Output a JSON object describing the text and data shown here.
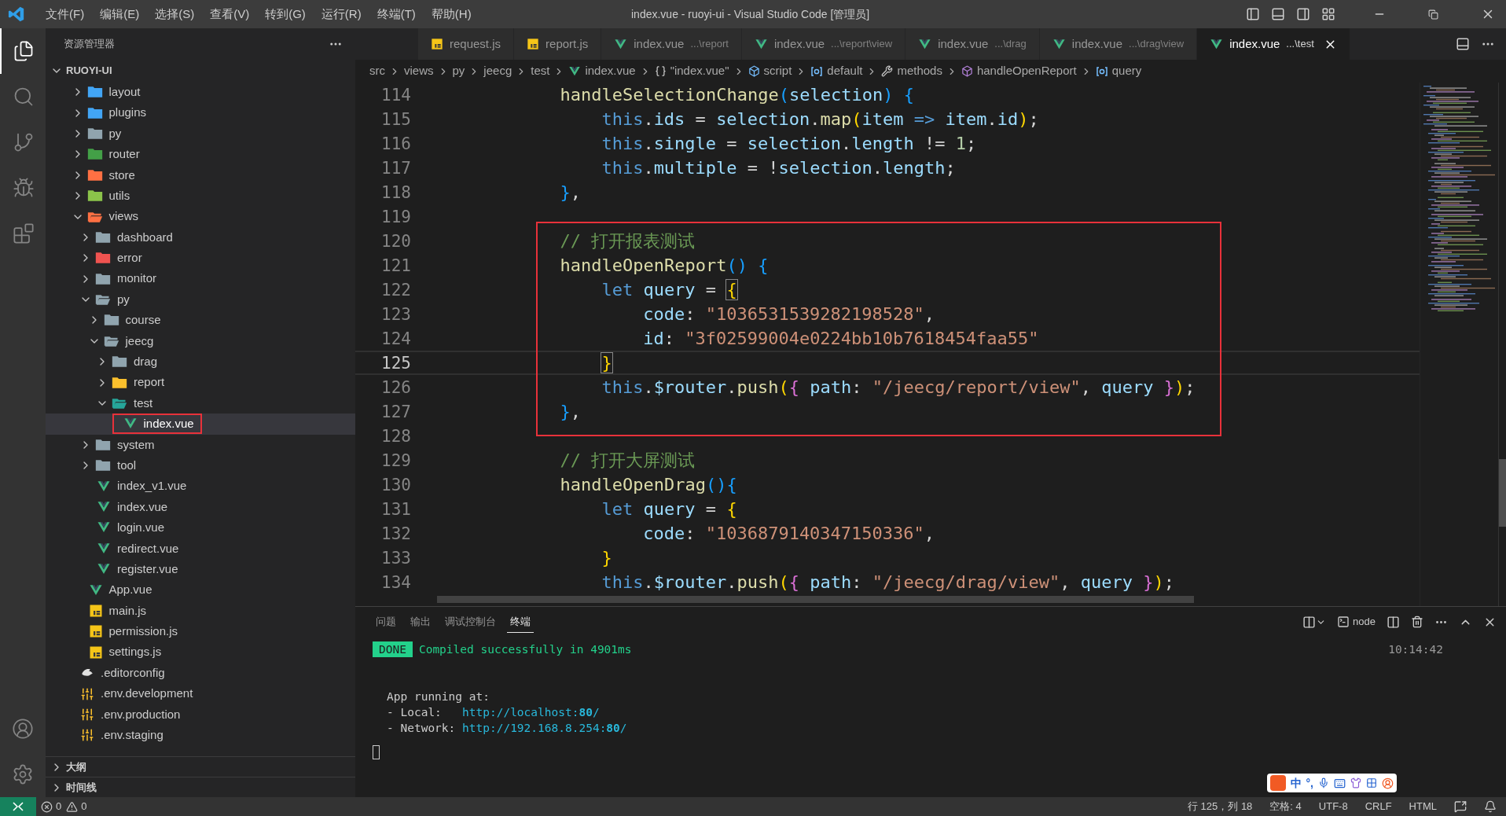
{
  "title_bar": {
    "menus": [
      "文件(F)",
      "编辑(E)",
      "选择(S)",
      "查看(V)",
      "转到(G)",
      "运行(R)",
      "终端(T)",
      "帮助(H)"
    ],
    "title": "index.vue - ruoyi-ui - Visual Studio Code [管理员]"
  },
  "activity_bar": {
    "items": [
      {
        "kind": "explorer",
        "selected": true
      },
      {
        "kind": "search",
        "selected": false
      },
      {
        "kind": "scm",
        "selected": false
      },
      {
        "kind": "debug",
        "selected": false
      },
      {
        "kind": "extensions",
        "selected": false
      }
    ],
    "bottom": [
      {
        "kind": "account"
      },
      {
        "kind": "settings"
      }
    ]
  },
  "explorer": {
    "title": "资源管理器",
    "root": "RUOYI-UI",
    "root_expanded": true,
    "tree": [
      {
        "children": [
          {
            "label": "layout",
            "kind": "folder",
            "color": "#42a5f5",
            "expanded": false
          },
          {
            "label": "plugins",
            "kind": "folder",
            "color": "#42a5f5",
            "expanded": false
          },
          {
            "label": "py",
            "kind": "folder",
            "color": "#90a4ae",
            "expanded": false
          },
          {
            "label": "router",
            "kind": "folder",
            "color": "#43a047",
            "expanded": false
          },
          {
            "label": "store",
            "kind": "folder",
            "color": "#ff7043",
            "expanded": false
          },
          {
            "label": "utils",
            "kind": "folder",
            "color": "#8bc34a",
            "expanded": false
          },
          {
            "label": "views",
            "kind": "folder",
            "color": "#ff7043",
            "expanded": true,
            "children": [
              {
                "label": "dashboard",
                "kind": "folder",
                "color": "#90a4ae",
                "expanded": false
              },
              {
                "label": "error",
                "kind": "folder",
                "color": "#ef5350",
                "expanded": false
              },
              {
                "label": "monitor",
                "kind": "folder",
                "color": "#90a4ae",
                "expanded": false
              },
              {
                "label": "py",
                "kind": "folder",
                "color": "#90a4ae",
                "expanded": true,
                "children": [
                  {
                    "label": "course",
                    "kind": "folder",
                    "color": "#90a4ae",
                    "expanded": false
                  },
                  {
                    "label": "jeecg",
                    "kind": "folder",
                    "color": "#90a4ae",
                    "expanded": true,
                    "children": [
                      {
                        "label": "drag",
                        "kind": "folder",
                        "color": "#90a4ae",
                        "expanded": false
                      },
                      {
                        "label": "report",
                        "kind": "folder",
                        "color": "#fbc02d",
                        "expanded": false
                      },
                      {
                        "label": "test",
                        "kind": "folder",
                        "color": "#26a69a",
                        "expanded": true,
                        "children": [
                          {
                            "label": "index.vue",
                            "kind": "vue",
                            "selected": true,
                            "boxed": true
                          }
                        ]
                      }
                    ]
                  }
                ]
              },
              {
                "label": "system",
                "kind": "folder",
                "color": "#90a4ae",
                "expanded": false
              },
              {
                "label": "tool",
                "kind": "folder",
                "color": "#90a4ae",
                "expanded": false
              },
              {
                "label": "index_v1.vue",
                "kind": "vue",
                "selected": false
              },
              {
                "label": "index.vue",
                "kind": "vue",
                "selected": false
              },
              {
                "label": "login.vue",
                "kind": "vue",
                "selected": false
              },
              {
                "label": "redirect.vue",
                "kind": "vue",
                "selected": false
              },
              {
                "label": "register.vue",
                "kind": "vue",
                "selected": false
              }
            ]
          },
          {
            "label": "App.vue",
            "kind": "vue",
            "selected": false
          },
          {
            "label": "main.js",
            "kind": "js",
            "selected": false
          },
          {
            "label": "permission.js",
            "kind": "js",
            "selected": false
          },
          {
            "label": "settings.js",
            "kind": "js",
            "selected": false
          }
        ]
      },
      {
        "label": ".editorconfig",
        "kind": "editorconfig",
        "selected": false
      },
      {
        "label": ".env.development",
        "kind": "env",
        "selected": false
      },
      {
        "label": ".env.production",
        "kind": "env",
        "selected": false
      },
      {
        "label": ".env.staging",
        "kind": "env",
        "selected": false
      }
    ],
    "sections": [
      {
        "label": "大纲",
        "expanded": false
      },
      {
        "label": "时间线",
        "expanded": false
      }
    ]
  },
  "tabs": [
    {
      "label": "request.js",
      "kind": "js",
      "selected": false
    },
    {
      "label": "report.js",
      "kind": "js",
      "selected": false
    },
    {
      "label": "index.vue",
      "detail": "...\\report",
      "kind": "vue",
      "selected": false
    },
    {
      "label": "index.vue",
      "detail": "...\\report\\view",
      "kind": "vue",
      "selected": false
    },
    {
      "label": "index.vue",
      "detail": "...\\drag",
      "kind": "vue",
      "selected": false
    },
    {
      "label": "index.vue",
      "detail": "...\\drag\\view",
      "kind": "vue",
      "selected": false
    },
    {
      "label": "index.vue",
      "detail": "...\\test",
      "kind": "vue",
      "selected": true
    }
  ],
  "breadcrumb": [
    {
      "label": "src",
      "kind": "path"
    },
    {
      "label": "views",
      "kind": "path"
    },
    {
      "label": "py",
      "kind": "path"
    },
    {
      "label": "jeecg",
      "kind": "path"
    },
    {
      "label": "test",
      "kind": "path"
    },
    {
      "label": "index.vue",
      "kind": "vue"
    },
    {
      "label": "\"index.vue\"",
      "kind": "braces"
    },
    {
      "label": "script",
      "kind": "cube"
    },
    {
      "label": "default",
      "kind": "ref"
    },
    {
      "label": "methods",
      "kind": "wrench"
    },
    {
      "label": "handleOpenReport",
      "kind": "method"
    },
    {
      "label": "query",
      "kind": "ref"
    }
  ],
  "editor": {
    "lines": [
      {
        "kind": "line",
        "number": "114",
        "selected": false,
        "tokens": [
          {
            "kind": "fn",
            "text": "handleSelectionChange"
          },
          {
            "kind": "b3",
            "text": "("
          },
          {
            "kind": "var",
            "text": "selection"
          },
          {
            "kind": "b3",
            "text": ") {"
          }
        ],
        "children": [
          {
            "kind": "line",
            "number": "115",
            "selected": false,
            "tokens": [
              {
                "kind": "kw",
                "text": "this"
              },
              {
                "kind": "p",
                "text": "."
              },
              {
                "kind": "var",
                "text": "ids"
              },
              {
                "kind": "p",
                "text": " = "
              },
              {
                "kind": "var",
                "text": "selection"
              },
              {
                "kind": "p",
                "text": "."
              },
              {
                "kind": "fn",
                "text": "map"
              },
              {
                "kind": "b1",
                "text": "("
              },
              {
                "kind": "var",
                "text": "item "
              },
              {
                "kind": "kw",
                "text": "=>"
              },
              {
                "kind": "var",
                "text": " item"
              },
              {
                "kind": "p",
                "text": "."
              },
              {
                "kind": "var",
                "text": "id"
              },
              {
                "kind": "b1",
                "text": ")"
              },
              {
                "kind": "p",
                "text": ";"
              }
            ]
          },
          {
            "kind": "line",
            "number": "116",
            "selected": false,
            "tokens": [
              {
                "kind": "kw",
                "text": "this"
              },
              {
                "kind": "p",
                "text": "."
              },
              {
                "kind": "var",
                "text": "single"
              },
              {
                "kind": "p",
                "text": " = "
              },
              {
                "kind": "var",
                "text": "selection"
              },
              {
                "kind": "p",
                "text": "."
              },
              {
                "kind": "var",
                "text": "length"
              },
              {
                "kind": "p",
                "text": " != "
              },
              {
                "kind": "num",
                "text": "1"
              },
              {
                "kind": "p",
                "text": ";"
              }
            ]
          },
          {
            "kind": "line",
            "number": "117",
            "selected": false,
            "tokens": [
              {
                "kind": "kw",
                "text": "this"
              },
              {
                "kind": "p",
                "text": "."
              },
              {
                "kind": "var",
                "text": "multiple"
              },
              {
                "kind": "p",
                "text": " = !"
              },
              {
                "kind": "var",
                "text": "selection"
              },
              {
                "kind": "p",
                "text": "."
              },
              {
                "kind": "var",
                "text": "length"
              },
              {
                "kind": "p",
                "text": ";"
              }
            ]
          }
        ]
      },
      {
        "kind": "line",
        "number": "118",
        "selected": false,
        "tokens": [
          {
            "kind": "b3",
            "text": "}"
          },
          {
            "kind": "p",
            "text": ","
          }
        ]
      },
      {
        "kind": "line",
        "number": "119",
        "selected": false
      },
      {
        "kind": "highlight",
        "children": [
          {
            "kind": "line",
            "number": "120",
            "selected": false,
            "tokens": [
              {
                "kind": "com",
                "text": "// 打开报表测试"
              }
            ]
          },
          {
            "kind": "line",
            "number": "121",
            "selected": false,
            "tokens": [
              {
                "kind": "fn",
                "text": "handleOpenReport"
              },
              {
                "kind": "b3",
                "text": "() {"
              }
            ],
            "children": [
              {
                "kind": "line",
                "number": "122",
                "selected": false,
                "tokens": [
                  {
                    "kind": "kw",
                    "text": "let"
                  },
                  {
                    "kind": "var",
                    "text": " query"
                  },
                  {
                    "kind": "p",
                    "text": " = "
                  },
                  {
                    "kind": "b1m",
                    "text": "{"
                  }
                ],
                "children": [
                  {
                    "kind": "line",
                    "number": "123",
                    "selected": false,
                    "tokens": [
                      {
                        "kind": "var",
                        "text": "code"
                      },
                      {
                        "kind": "p",
                        "text": ": "
                      },
                      {
                        "kind": "str",
                        "text": "\"1036531539282198528\""
                      },
                      {
                        "kind": "p",
                        "text": ","
                      }
                    ]
                  },
                  {
                    "kind": "line",
                    "number": "124",
                    "selected": false,
                    "tokens": [
                      {
                        "kind": "var",
                        "text": "id"
                      },
                      {
                        "kind": "p",
                        "text": ": "
                      },
                      {
                        "kind": "str",
                        "text": "\"3f02599004e0224bb10b7618454faa55\""
                      }
                    ]
                  }
                ]
              },
              {
                "kind": "line",
                "number": "125",
                "selected": true,
                "tokens": [
                  {
                    "kind": "b1m",
                    "text": "}"
                  }
                ]
              },
              {
                "kind": "line",
                "number": "126",
                "selected": false,
                "tokens": [
                  {
                    "kind": "kw",
                    "text": "this"
                  },
                  {
                    "kind": "p",
                    "text": "."
                  },
                  {
                    "kind": "var",
                    "text": "$router"
                  },
                  {
                    "kind": "p",
                    "text": "."
                  },
                  {
                    "kind": "fn",
                    "text": "push"
                  },
                  {
                    "kind": "b1",
                    "text": "("
                  },
                  {
                    "kind": "b2",
                    "text": "{ "
                  },
                  {
                    "kind": "var",
                    "text": "path"
                  },
                  {
                    "kind": "p",
                    "text": ": "
                  },
                  {
                    "kind": "str",
                    "text": "\"/jeecg/report/view\""
                  },
                  {
                    "kind": "p",
                    "text": ", "
                  },
                  {
                    "kind": "var",
                    "text": "query"
                  },
                  {
                    "kind": "b2",
                    "text": " }"
                  },
                  {
                    "kind": "b1",
                    "text": ")"
                  },
                  {
                    "kind": "p",
                    "text": ";"
                  }
                ]
              }
            ]
          },
          {
            "kind": "line",
            "number": "127",
            "selected": false,
            "tokens": [
              {
                "kind": "b3",
                "text": "}"
              },
              {
                "kind": "p",
                "text": ","
              }
            ]
          }
        ]
      },
      {
        "kind": "line",
        "number": "128",
        "selected": false
      },
      {
        "kind": "line",
        "number": "129",
        "selected": false,
        "tokens": [
          {
            "kind": "com",
            "text": "// 打开大屏测试"
          }
        ]
      },
      {
        "kind": "line",
        "number": "130",
        "selected": false,
        "tokens": [
          {
            "kind": "fn",
            "text": "handleOpenDrag"
          },
          {
            "kind": "b3",
            "text": "(){"
          }
        ],
        "children": [
          {
            "kind": "line",
            "number": "131",
            "selected": false,
            "tokens": [
              {
                "kind": "kw",
                "text": "let"
              },
              {
                "kind": "var",
                "text": " query"
              },
              {
                "kind": "p",
                "text": " = "
              },
              {
                "kind": "b1",
                "text": "{"
              }
            ],
            "children": [
              {
                "kind": "line",
                "number": "132",
                "selected": false,
                "tokens": [
                  {
                    "kind": "var",
                    "text": "code"
                  },
                  {
                    "kind": "p",
                    "text": ": "
                  },
                  {
                    "kind": "str",
                    "text": "\"1036879140347150336\""
                  },
                  {
                    "kind": "p",
                    "text": ","
                  }
                ]
              }
            ]
          },
          {
            "kind": "line",
            "number": "133",
            "selected": false,
            "tokens": [
              {
                "kind": "b1",
                "text": "}"
              }
            ]
          },
          {
            "kind": "line",
            "number": "134",
            "selected": false,
            "tokens": [
              {
                "kind": "kw",
                "text": "this"
              },
              {
                "kind": "p",
                "text": "."
              },
              {
                "kind": "var",
                "text": "$router"
              },
              {
                "kind": "p",
                "text": "."
              },
              {
                "kind": "fn",
                "text": "push"
              },
              {
                "kind": "b1",
                "text": "("
              },
              {
                "kind": "b2",
                "text": "{ "
              },
              {
                "kind": "var",
                "text": "path"
              },
              {
                "kind": "p",
                "text": ": "
              },
              {
                "kind": "str",
                "text": "\"/jeecg/drag/view\""
              },
              {
                "kind": "p",
                "text": ", "
              },
              {
                "kind": "var",
                "text": "query"
              },
              {
                "kind": "b2",
                "text": " }"
              },
              {
                "kind": "b1",
                "text": ")"
              },
              {
                "kind": "p",
                "text": ";"
              }
            ]
          }
        ]
      }
    ]
  },
  "panel": {
    "tabs": [
      {
        "label": "问题",
        "selected": false
      },
      {
        "label": "输出",
        "selected": false
      },
      {
        "label": "调试控制台",
        "selected": false
      },
      {
        "label": "终端",
        "selected": true
      }
    ],
    "terminal_name": "node",
    "terminal": {
      "badge": "DONE",
      "message": "Compiled successfully in 4901ms",
      "time": "10:14:42",
      "lines": [
        {
          "kind": "text",
          "text": "App running at:"
        },
        {
          "kind": "link",
          "label": "- Local:   ",
          "url": "http://localhost:**80**/"
        },
        {
          "kind": "link",
          "label": "- Network: ",
          "url": "http://192.168.8.254:**80**/"
        }
      ]
    }
  },
  "ime_toolbar": {
    "mode": "中",
    "punct": "°,"
  },
  "status_bar": {
    "errors": "0",
    "warnings": "0",
    "items": [
      "行 125，列 18",
      "空格: 4",
      "UTF-8",
      "CRLF",
      "HTML"
    ]
  }
}
